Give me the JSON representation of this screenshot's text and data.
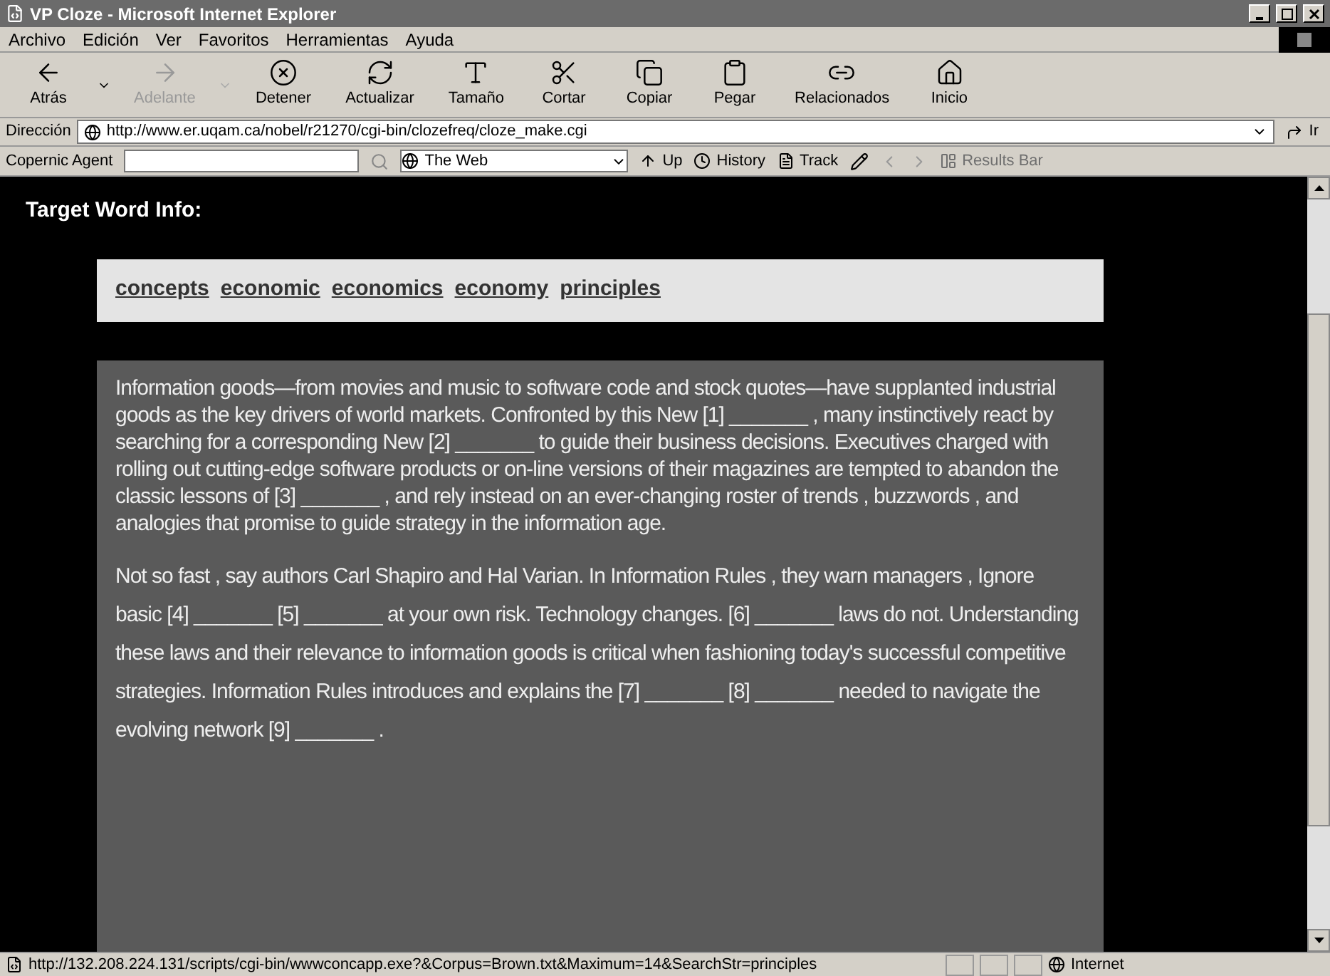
{
  "window": {
    "title": "VP Cloze - Microsoft Internet Explorer"
  },
  "menu": [
    "Archivo",
    "Edición",
    "Ver",
    "Favoritos",
    "Herramientas",
    "Ayuda"
  ],
  "toolbar": [
    {
      "label": "Atrás",
      "kind": "back",
      "disabled": false,
      "dropdown": true
    },
    {
      "label": "Adelante",
      "kind": "forward",
      "disabled": true,
      "dropdown": true
    },
    {
      "label": "Detener",
      "kind": "stop",
      "disabled": false,
      "dropdown": false
    },
    {
      "label": "Actualizar",
      "kind": "refresh",
      "disabled": false,
      "dropdown": false
    },
    {
      "label": "Tamaño",
      "kind": "size",
      "disabled": false,
      "dropdown": false
    },
    {
      "label": "Cortar",
      "kind": "cut",
      "disabled": false,
      "dropdown": false
    },
    {
      "label": "Copiar",
      "kind": "copy",
      "disabled": false,
      "dropdown": false
    },
    {
      "label": "Pegar",
      "kind": "paste",
      "disabled": false,
      "dropdown": false
    },
    {
      "label": "Relacionados",
      "kind": "related",
      "disabled": false,
      "dropdown": false
    },
    {
      "label": "Inicio",
      "kind": "home",
      "disabled": false,
      "dropdown": false
    }
  ],
  "address": {
    "label": "Dirección",
    "value": "http://www.er.uqam.ca/nobel/r21270/cgi-bin/clozefreq/cloze_make.cgi",
    "go": "Ir"
  },
  "copernic": {
    "label": "Copernic Agent",
    "engine": "The Web",
    "buttons": [
      {
        "label": "Up",
        "disabled": false
      },
      {
        "label": "History",
        "disabled": false
      },
      {
        "label": "Track",
        "disabled": false
      },
      {
        "label": "Results Bar",
        "disabled": true
      }
    ]
  },
  "page": {
    "heading": "Target Word Info:",
    "target_words": [
      "concepts",
      "economic",
      "economics",
      "economy",
      "principles"
    ],
    "paragraphs": [
      "Information goods—from movies and music to software code and stock quotes—have supplanted industrial goods as the key drivers of world markets. Confronted by this New [1] _______ , many instinctively react by searching for a corresponding New [2] _______ to guide their business decisions. Executives charged with rolling out cutting-edge software products or on-line versions of their magazines are tempted to abandon the classic lessons of [3] _______ , and rely instead on an ever-changing roster of trends , buzzwords , and analogies that promise to guide strategy in the information age.",
      "Not so fast , say authors Carl Shapiro and Hal Varian. In Information Rules , they warn managers , Ignore basic [4] _______ [5] _______ at your own risk. Technology changes. [6] _______ laws do not. Understanding these laws and their relevance to information goods is critical when fashioning today's successful competitive strategies. Information Rules introduces and explains the [7] _______ [8] _______ needed to navigate the evolving network [9] _______ ."
    ]
  },
  "status_bar": {
    "url": "http://132.208.224.131/scripts/cgi-bin/wwwconcapp.exe?&Corpus=Brown.txt&Maximum=14&SearchStr=principles",
    "zone": "Internet"
  }
}
